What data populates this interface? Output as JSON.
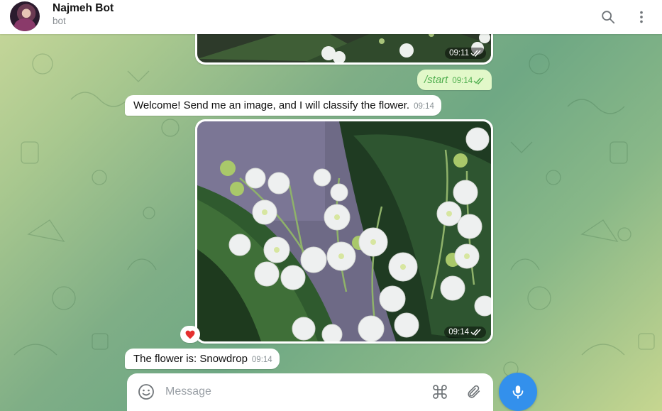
{
  "header": {
    "title": "Najmeh Bot",
    "subtitle": "bot",
    "search_icon": "search-icon",
    "more_icon": "more-vertical-icon"
  },
  "messages": [
    {
      "type": "photo",
      "direction": "out",
      "time": "09:11",
      "status": "read"
    },
    {
      "type": "text",
      "direction": "out",
      "text": "/start",
      "time": "09:14",
      "status": "read"
    },
    {
      "type": "text",
      "direction": "in",
      "text": "Welcome! Send me an image, and I will classify the flower.",
      "time": "09:14"
    },
    {
      "type": "photo",
      "direction": "out",
      "time": "09:14",
      "status": "read",
      "reaction": "heart"
    },
    {
      "type": "text",
      "direction": "in",
      "text": "The flower is: Snowdrop",
      "time": "09:14"
    }
  ],
  "composer": {
    "placeholder": "Message",
    "emoji_icon": "emoji-icon",
    "command_icon": "command-icon",
    "attach_icon": "paperclip-icon",
    "mic_icon": "microphone-icon"
  },
  "colors": {
    "outgoing_bubble": "#e2f8c9",
    "incoming_bubble": "#ffffff",
    "accent": "#3390ec",
    "read_check": "#4fae4e"
  }
}
